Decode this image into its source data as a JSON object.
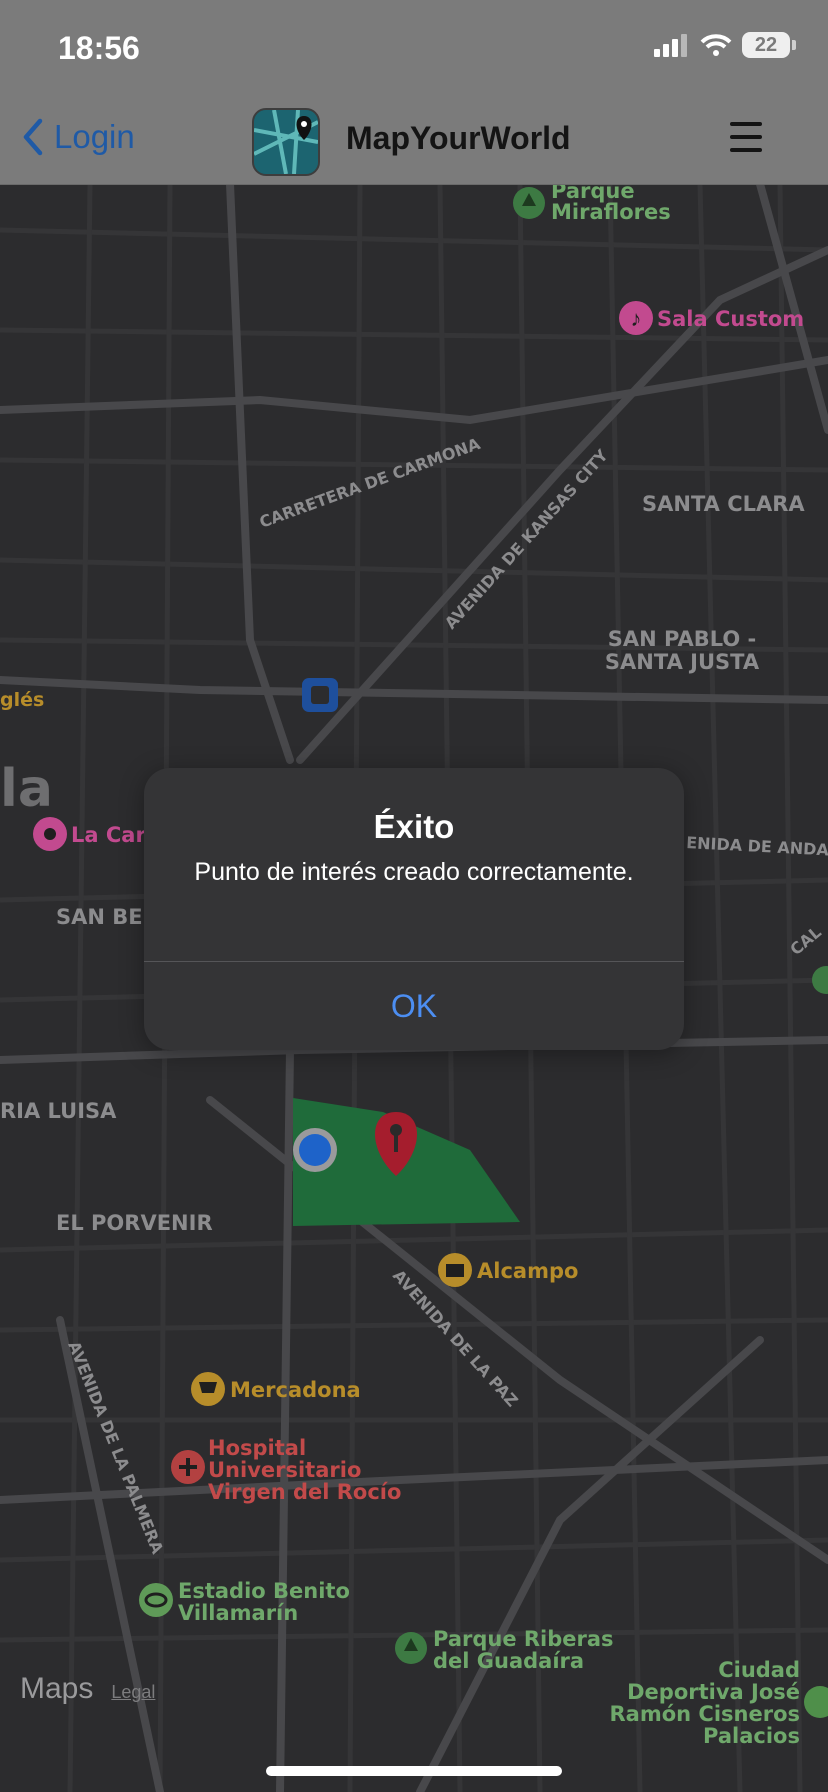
{
  "status_bar": {
    "time": "18:56",
    "battery": "22"
  },
  "nav": {
    "back_label": "Login",
    "title": "MapYourWorld"
  },
  "map": {
    "pois": {
      "parque_miraflores": [
        "Parque",
        "Miraflores"
      ],
      "sala_custom": "Sala Custom",
      "la_carb": "La Carb",
      "ingles": "glés",
      "alcampo": "Alcampo",
      "mercadona": "Mercadona",
      "hospital": [
        "Hospital",
        "Universitario",
        "Virgen del Rocío"
      ],
      "estadio": [
        "Estadio Benito",
        "Villamarín"
      ],
      "parque_riberas": [
        "Parque Riberas",
        "del Guadaíra"
      ],
      "ciudad_deportiva": [
        "Ciudad",
        "Deportiva José",
        "Ramón Cisneros",
        "Palacios"
      ]
    },
    "areas": {
      "santa_clara": "SANTA CLARA",
      "san_pablo": [
        "SAN PABLO -",
        "SANTA JUSTA"
      ],
      "san_beri": "SAN BERI",
      "maria_luisa": "RIA LUISA",
      "el_porvenir": "EL PORVENIR",
      "city_fragment": "la"
    },
    "streets": {
      "carretera_carmona": "CARRETERA DE CARMONA",
      "avenida_kansas": "AVENIDA DE KANSAS CITY",
      "avenida_andalucia": "ENIDA DE ANDAL",
      "avenida_paz": "AVENIDA DE LA PAZ",
      "avenida_palmera": "AVENIDA DE LA PALMERA",
      "cal_fragment": "CAL"
    },
    "attribution": {
      "logo": "Maps",
      "legal": "Legal"
    },
    "colors": {
      "park": "#1f6b3a",
      "user_dot": "#1e63c9",
      "pin": "#a51d2d",
      "poi_green": "#6fa86b",
      "poi_pink": "#c24a8f",
      "poi_gold": "#b78d2a"
    }
  },
  "dialog": {
    "title": "Éxito",
    "message": "Punto de interés creado correctamente.",
    "button": "OK"
  }
}
